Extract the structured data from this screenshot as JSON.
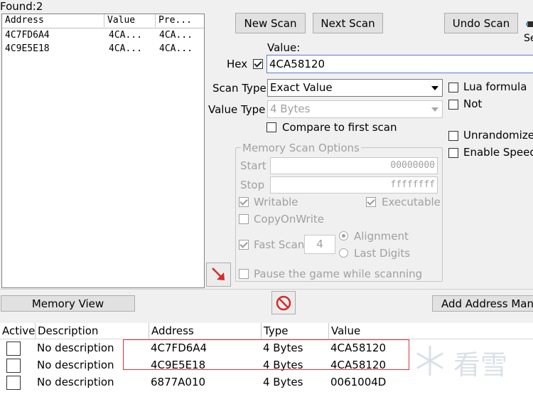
{
  "found": "Found:2",
  "found_list": {
    "columns": [
      "Address",
      "Value",
      "Pre..."
    ],
    "rows": [
      {
        "address": "4C7FD6A4",
        "value": "4CA...",
        "previous": "4CA..."
      },
      {
        "address": "4C9E5E18",
        "value": "4CA...",
        "previous": "4CA..."
      }
    ]
  },
  "buttons": {
    "new_scan": "New Scan",
    "next_scan": "Next Scan",
    "undo_scan": "Undo Scan",
    "memory_view": "Memory View",
    "add_address": "Add Address Man",
    "settings_partial": "Se"
  },
  "value": {
    "label": "Value:",
    "hex_label": "Hex",
    "hex_checked": true,
    "input": "4CA58120"
  },
  "scan_type": {
    "label": "Scan Type",
    "selected": "Exact Value"
  },
  "value_type": {
    "label": "Value Type",
    "selected": "4 Bytes"
  },
  "compare_first": "Compare to first scan",
  "options_right": {
    "lua_formula": "Lua formula",
    "not": "Not",
    "unrandomizer": "Unrandomize",
    "enable_speedhack": "Enable Speed"
  },
  "memory_options": {
    "title": "Memory Scan Options",
    "start_label": "Start",
    "start_value": "00000000",
    "stop_label": "Stop",
    "stop_value": "ffffffff",
    "writable": "Writable",
    "executable": "Executable",
    "copy_on_write": "CopyOnWrite",
    "fast_scan": "Fast Scan",
    "fast_scan_value": "4",
    "alignment": "Alignment",
    "last_digits": "Last Digits",
    "pause_game": "Pause the game while scanning"
  },
  "address_table": {
    "columns": [
      "Active",
      "Description",
      "Address",
      "Type",
      "Value"
    ],
    "rows": [
      {
        "description": "No description",
        "address": "4C7FD6A4",
        "type": "4 Bytes",
        "value": "4CA58120"
      },
      {
        "description": "No description",
        "address": "4C9E5E18",
        "type": "4 Bytes",
        "value": "4CA58120"
      },
      {
        "description": "No description",
        "address": "6877A010",
        "type": "4 Bytes",
        "value": "0061004D"
      }
    ]
  },
  "watermark": "看雪",
  "colors": {
    "highlight_box": "#e0313a",
    "arrow": "#d42b2b",
    "stop_icon": "#d42b2b"
  }
}
